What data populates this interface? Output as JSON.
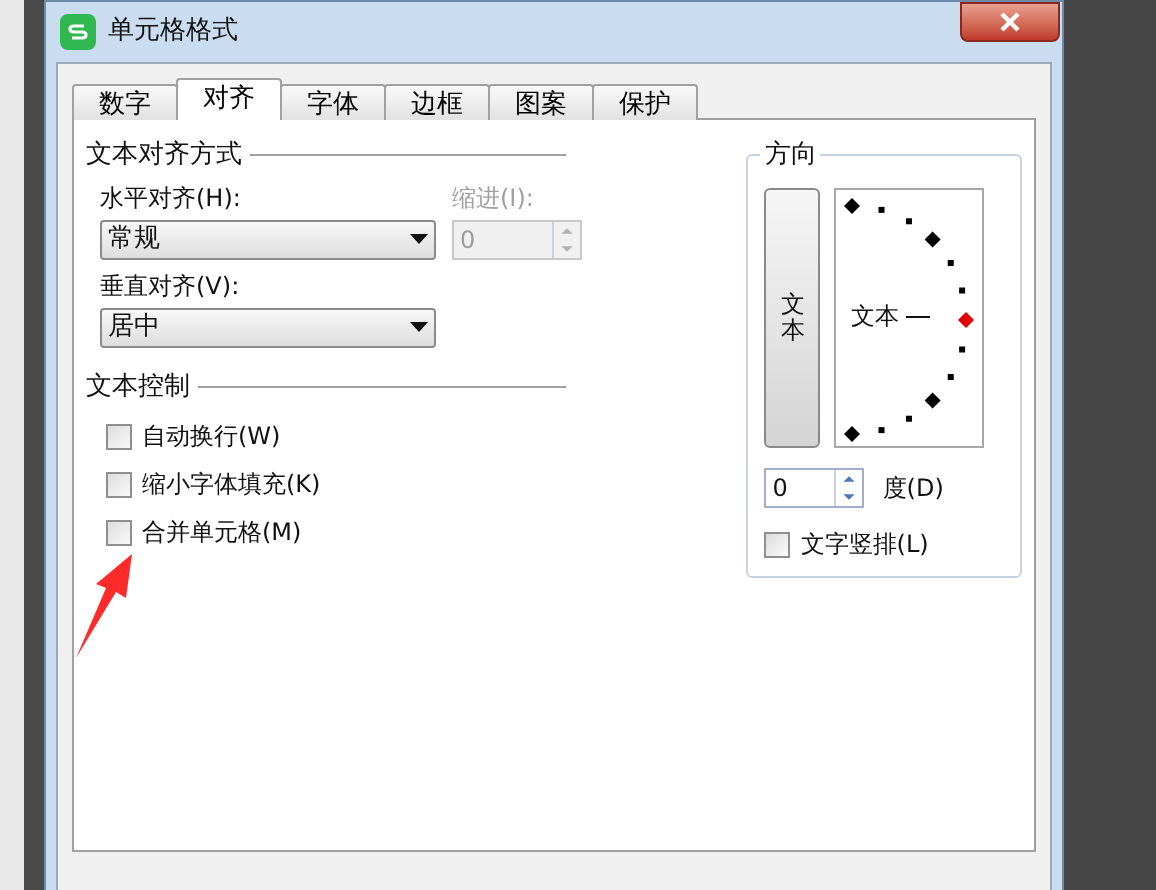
{
  "window": {
    "title": "单元格格式"
  },
  "tabs": [
    {
      "label": "数字",
      "selected": false
    },
    {
      "label": "对齐",
      "selected": true
    },
    {
      "label": "字体",
      "selected": false
    },
    {
      "label": "边框",
      "selected": false
    },
    {
      "label": "图案",
      "selected": false
    },
    {
      "label": "保护",
      "selected": false
    }
  ],
  "alignment": {
    "title": "文本对齐方式",
    "horizontal": {
      "label": "水平对齐(H):",
      "value": "常规"
    },
    "indent": {
      "label": "缩进(I):",
      "value": "0",
      "disabled": true
    },
    "vertical": {
      "label": "垂直对齐(V):",
      "value": "居中"
    }
  },
  "text_control": {
    "title": "文本控制",
    "options": [
      {
        "label": "自动换行(W)",
        "checked": false
      },
      {
        "label": "缩小字体填充(K)",
        "checked": false
      },
      {
        "label": "合并单元格(M)",
        "checked": false
      }
    ]
  },
  "orientation": {
    "title": "方向",
    "vertical_text_button": "文本",
    "dial_text": "文本",
    "degrees": {
      "value": "0",
      "label": "度(D)"
    },
    "stacked": {
      "label": "文字竖排(L)",
      "checked": false
    }
  }
}
